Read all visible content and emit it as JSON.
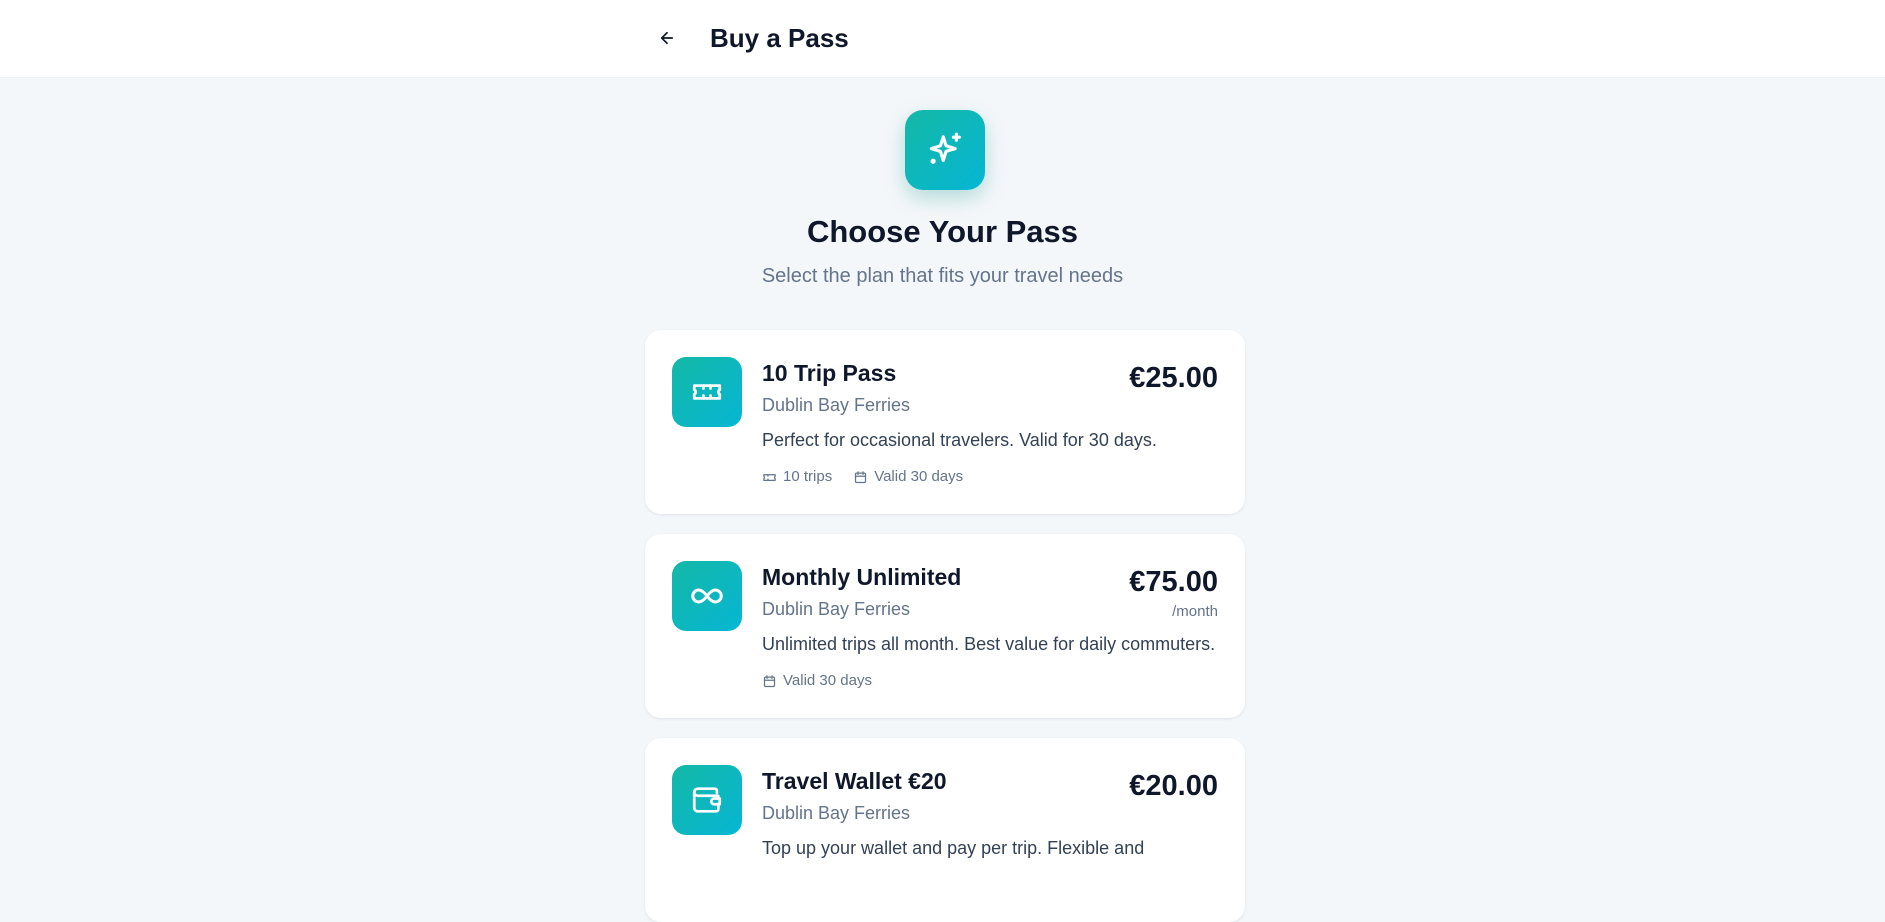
{
  "header": {
    "title": "Buy a Pass",
    "back_icon": "arrow-left-icon"
  },
  "hero": {
    "icon": "sparkles-icon",
    "title": "Choose Your Pass",
    "subtitle": "Select the plan that fits your travel needs"
  },
  "colors": {
    "accent": "#14b8a6",
    "accent_end": "#06b6d4",
    "text_primary": "#0f172a",
    "text_muted": "#64748b",
    "background": "#f4f7fa"
  },
  "passes": [
    {
      "icon": "ticket-icon",
      "name": "10 Trip Pass",
      "operator": "Dublin Bay Ferries",
      "price": "€25.00",
      "period": "",
      "description": "Perfect for occasional travelers. Valid for 30 days.",
      "trips": "10 trips",
      "validity": "Valid 30 days"
    },
    {
      "icon": "infinity-icon",
      "name": "Monthly Unlimited",
      "operator": "Dublin Bay Ferries",
      "price": "€75.00",
      "period": "/month",
      "description": "Unlimited trips all month. Best value for daily commuters.",
      "validity": "Valid 30 days"
    },
    {
      "icon": "wallet-icon",
      "name": "Travel Wallet €20",
      "operator": "Dublin Bay Ferries",
      "price": "€20.00",
      "description": "Top up your wallet and pay per trip. Flexible and"
    }
  ]
}
